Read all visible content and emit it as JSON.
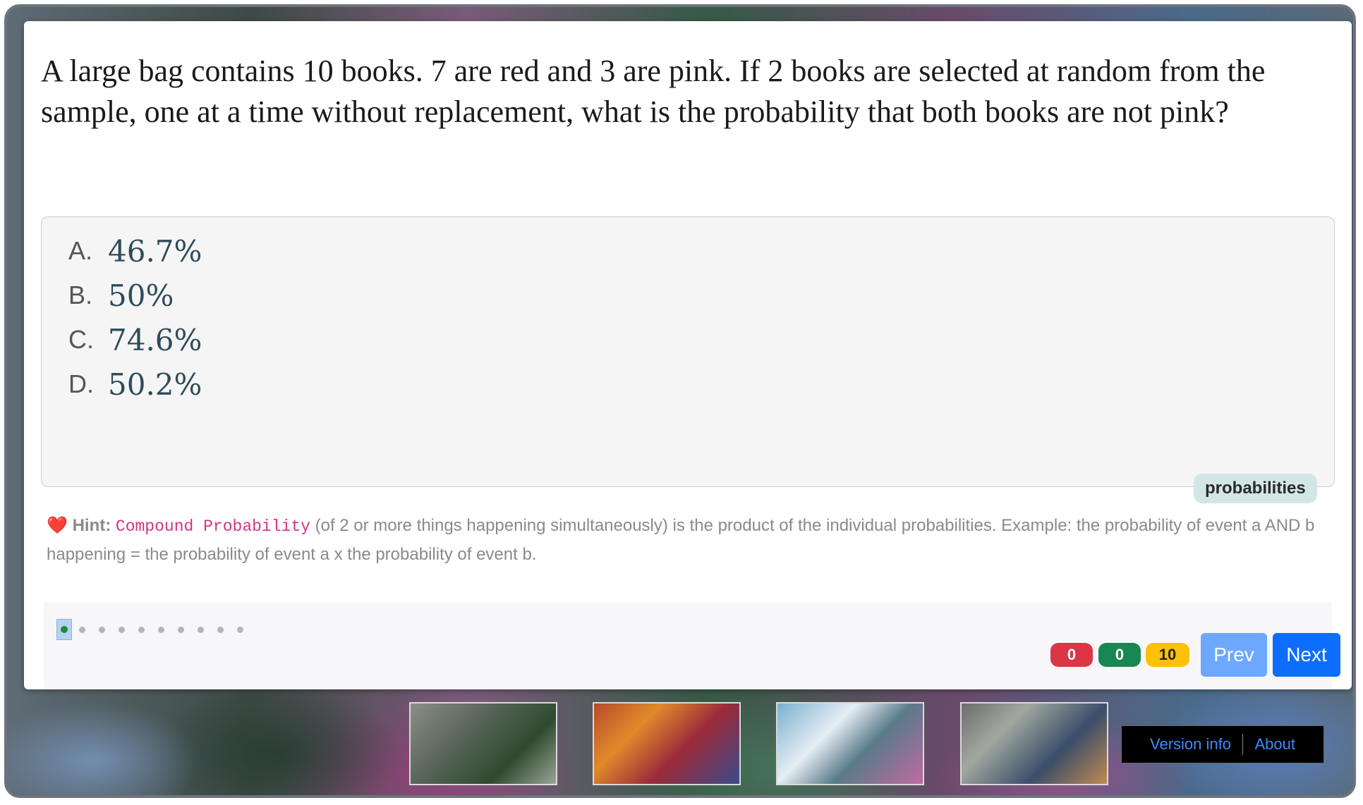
{
  "question": {
    "text": "A large bag contains 10 books. 7 are red and 3 are pink. If 2 books are selected at random from the sample, one at a time without replacement, what is the probability that both books are not pink?"
  },
  "choices": [
    {
      "letter": "A.",
      "value": "46.7%"
    },
    {
      "letter": "B.",
      "value": "50%"
    },
    {
      "letter": "C.",
      "value": "74.6%"
    },
    {
      "letter": "D.",
      "value": "50.2%"
    }
  ],
  "topic_tag": "probabilities",
  "hint": {
    "icon": "heart-icon",
    "label": "Hint:",
    "term": "Compound Probability",
    "text": "(of 2 or more things happening simultaneously) is the product of the individual probabilities. Example: the probability of event a AND b happening = the probability of event a x the probability of event b."
  },
  "progress": {
    "total_questions": 10,
    "current_index": 1
  },
  "scores": {
    "wrong": "0",
    "correct": "0",
    "remaining": "10"
  },
  "nav": {
    "prev_label": "Prev",
    "next_label": "Next"
  },
  "footer_links": {
    "version_label": "Version info",
    "about_label": "About"
  },
  "colors": {
    "wrong": "#dc3545",
    "correct": "#198754",
    "remaining": "#ffc107",
    "primary": "#0d6efd"
  }
}
